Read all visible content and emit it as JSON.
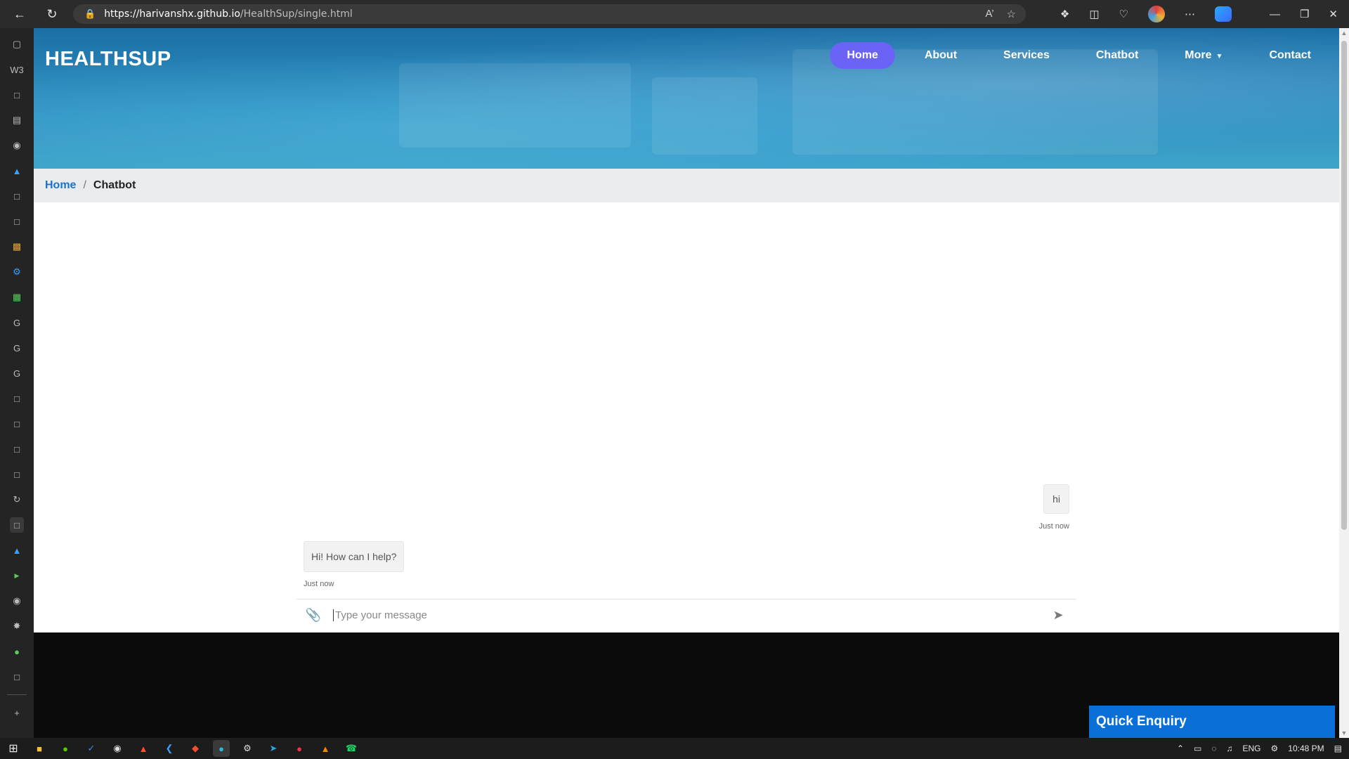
{
  "browser": {
    "url_host": "https://harivanshx.github.io",
    "url_path": "/HealthSup/single.html",
    "addr_icons": [
      "read-aloud-icon",
      "favorite-star-icon"
    ],
    "toolbar_icons": [
      "extensions-icon",
      "split-screen-icon",
      "browser-essentials-icon",
      "profile-avatar",
      "more-icon",
      "copilot-icon"
    ],
    "window_controls": [
      "minimize-icon",
      "restore-icon",
      "close-icon"
    ]
  },
  "site": {
    "brand": "HEALTHSUP",
    "nav": [
      {
        "label": "Home",
        "active": true
      },
      {
        "label": "About"
      },
      {
        "label": "Services"
      },
      {
        "label": "Chatbot"
      },
      {
        "label": "More"
      },
      {
        "label": "Contact"
      }
    ]
  },
  "breadcrumb": {
    "home": "Home",
    "separator": "/",
    "current": "Chatbot"
  },
  "chat": {
    "messages": [
      {
        "from": "user",
        "text": "hi",
        "time": "Just now"
      },
      {
        "from": "bot",
        "text": "Hi! How can I help?",
        "time": "Just now"
      }
    ],
    "input_placeholder": "Type your message"
  },
  "quick_enquiry": "Quick Enquiry",
  "taskbar": {
    "language": "ENG",
    "time": "10:48 PM"
  },
  "colors": {
    "nav_active": "#6b63f5",
    "link": "#1a73c8",
    "quick_enquiry_bg": "#0a6fd6",
    "footer_bg": "#0b0b0b"
  }
}
